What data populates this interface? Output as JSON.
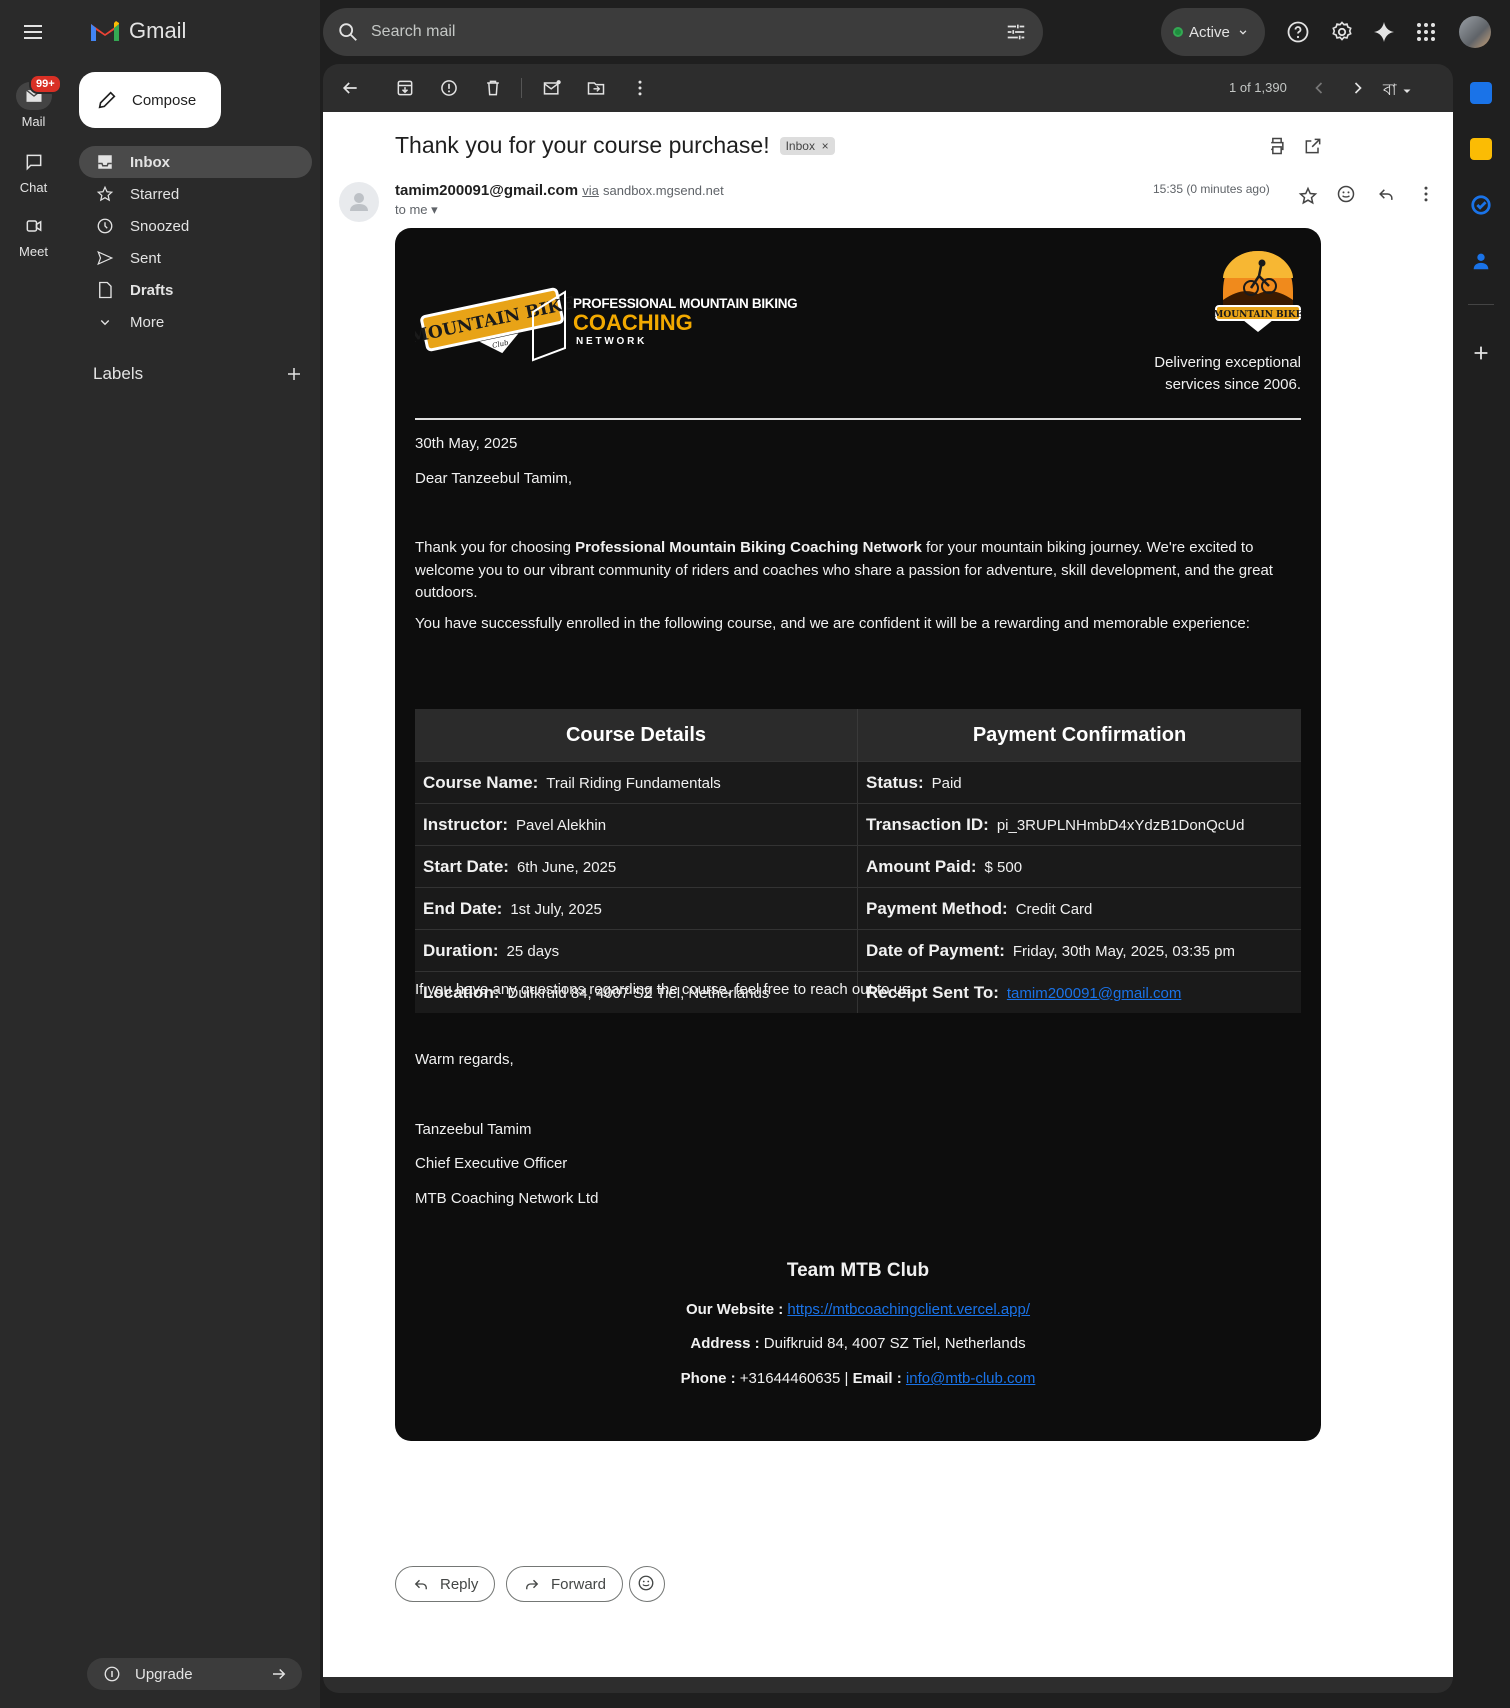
{
  "app": {
    "name": "Gmail"
  },
  "rail": {
    "mail_label": "Mail",
    "mail_badge": "99+",
    "chat_label": "Chat",
    "meet_label": "Meet"
  },
  "nav": {
    "compose": "Compose",
    "items": [
      {
        "label": "Inbox",
        "icon": "inbox-icon"
      },
      {
        "label": "Starred",
        "icon": "star-icon"
      },
      {
        "label": "Snoozed",
        "icon": "clock-icon"
      },
      {
        "label": "Sent",
        "icon": "send-icon"
      },
      {
        "label": "Drafts",
        "icon": "draft-icon"
      },
      {
        "label": "More",
        "icon": "chevron-down-icon"
      }
    ],
    "labels_heading": "Labels",
    "upgrade": "Upgrade"
  },
  "top": {
    "search_placeholder": "Search mail",
    "status": "Active"
  },
  "toolbar": {
    "pager": "1 of 1,390",
    "lang_glyph": "বা"
  },
  "message": {
    "subject": "Thank you for your course purchase!",
    "label_chip": "Inbox",
    "sender_email": "tamim200091@gmail.com",
    "via_word": "via",
    "via_domain": "sandbox.mgsend.net",
    "to": "to me",
    "timestamp": "15:35 (0 minutes ago)"
  },
  "email": {
    "brand_line1": "PROFESSIONAL MOUNTAIN BIKING",
    "brand_line2": "COACHING",
    "brand_line3": "N E T W O R K",
    "brand_badge": "MOUNTAIN BIKE",
    "brand_badge_sub": "Club",
    "tagline": "Delivering exceptional services since 2006.",
    "date": "30th May, 2025",
    "greeting": "Dear Tanzeebul Tamim,",
    "para1_pre": "Thank you for choosing ",
    "para1_bold": "Professional Mountain Biking Coaching Network",
    "para1_post": " for your mountain biking journey. We're excited to welcome you to our vibrant community of riders and coaches who share a passion for adventure, skill development, and the great outdoors.",
    "para2": "You have successfully enrolled in the following course, and we are confident it will be a rewarding and memorable experience:",
    "table": {
      "head_left": "Course Details",
      "head_right": "Payment Confirmation",
      "rows": [
        {
          "lk": "Course Name:",
          "lv": "Trail Riding Fundamentals",
          "rk": "Status:",
          "rv": "Paid"
        },
        {
          "lk": "Instructor:",
          "lv": "Pavel Alekhin",
          "rk": "Transaction ID:",
          "rv": "pi_3RUPLNHmbD4xYdzB1DonQcUd"
        },
        {
          "lk": "Start Date:",
          "lv": "6th June, 2025",
          "rk": "Amount Paid:",
          "rv": "$ 500"
        },
        {
          "lk": "End Date:",
          "lv": "1st July, 2025",
          "rk": "Payment Method:",
          "rv": "Credit Card"
        },
        {
          "lk": "Duration:",
          "lv": "25 days",
          "rk": "Date of Payment:",
          "rv": "Friday, 30th May, 2025, 03:35 pm"
        },
        {
          "lk": "Location:",
          "lv": "Duifkruid 84, 4007 SZ Tiel, Netherlands",
          "rk": "Receipt Sent To:",
          "rv": "tamim200091@gmail.com"
        }
      ]
    },
    "questions": "If you have any questions regarding the course, feel free to reach out to us.",
    "regards": "Warm regards,",
    "sig_name": "Tanzeebul Tamim",
    "sig_title": "Chief Executive Officer",
    "sig_company": "MTB Coaching Network Ltd",
    "team_title": "Team MTB Club",
    "website_label": "Our Website :",
    "website_url": "https://mtbcoachingclient.vercel.app/",
    "address_label": "Address :",
    "address_value": "Duifkruid 84, 4007 SZ Tiel, Netherlands",
    "phone_label": "Phone :",
    "phone_value": "+31644460635 |",
    "email_label": "Email :",
    "email_value": "info@mtb-club.com"
  },
  "actions": {
    "reply": "Reply",
    "forward": "Forward"
  },
  "colors": {
    "accent_brand": "#f2a900",
    "link": "#1a73e8",
    "card_bg": "#0d0d0d"
  }
}
